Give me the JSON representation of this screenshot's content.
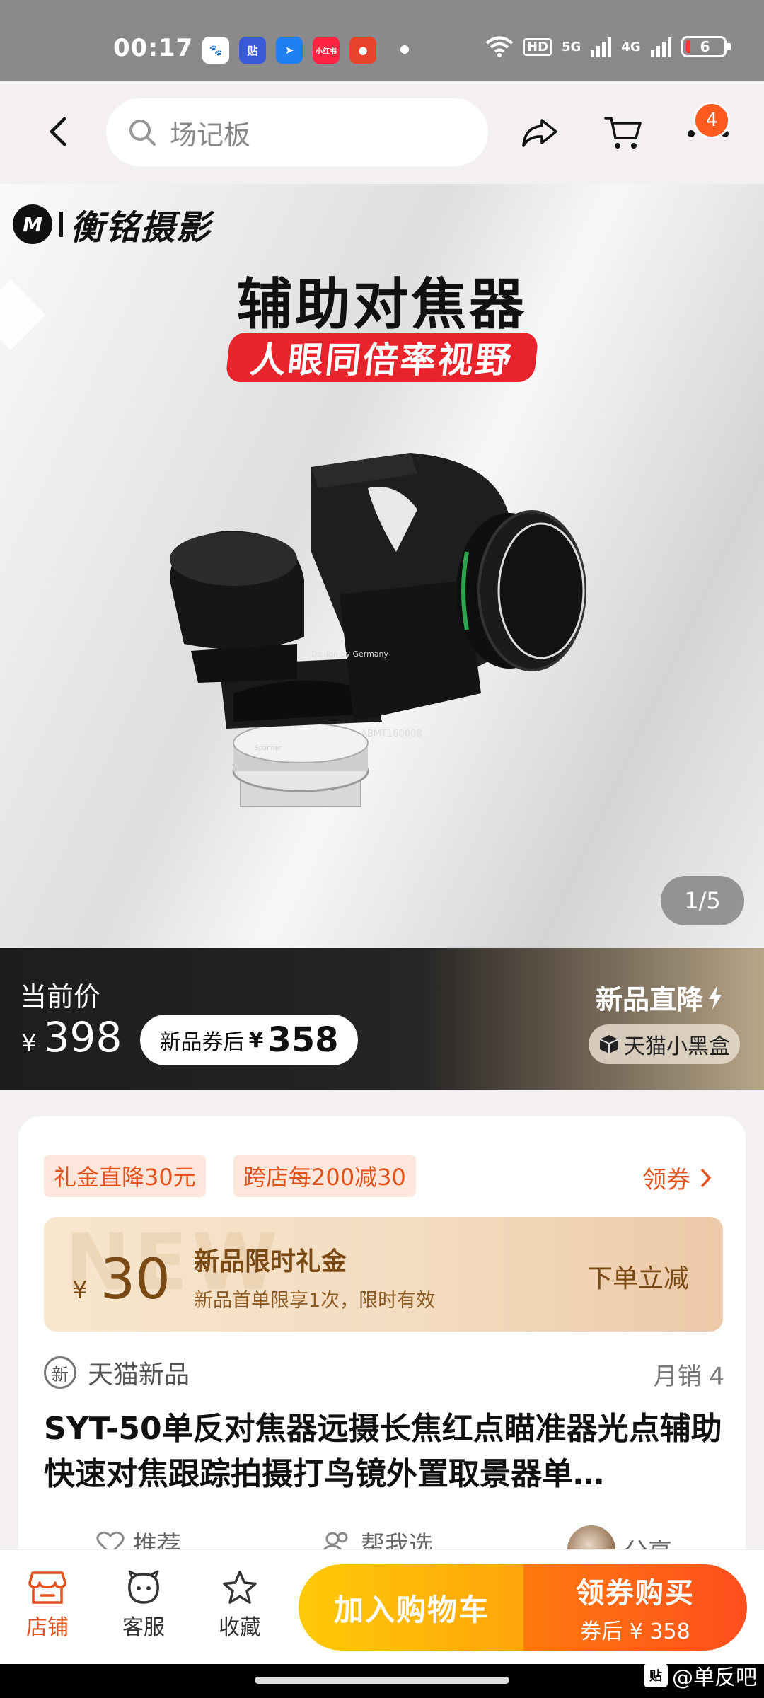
{
  "status_bar": {
    "time": "00:17",
    "apps": [
      {
        "icon": "baidu-app-icon",
        "glyph": "🐾",
        "color": "#ffffff",
        "text_color": "#2f5bd6"
      },
      {
        "icon": "tieba-app-icon",
        "glyph": "贴",
        "color": "#3a5bd9",
        "text_color": "#ffffff"
      },
      {
        "icon": "arrow-app-icon",
        "glyph": "➤",
        "color": "#1f7ef0",
        "text_color": "#ffffff"
      },
      {
        "icon": "xiaohongshu-app-icon",
        "glyph": "小红书",
        "color": "#ff2442",
        "text_color": "#ffffff"
      },
      {
        "icon": "game-app-icon",
        "glyph": "●",
        "color": "#e8422a",
        "text_color": "#ffffff"
      }
    ],
    "hd_label": "HD",
    "network_1": "5G",
    "network_2": "4G",
    "battery": "6"
  },
  "nav": {
    "search_placeholder": "场记板",
    "cart_badge": "4"
  },
  "gallery": {
    "brand_mark": "M",
    "brand_name": "衡铭摄影",
    "promo_title": "辅助对焦器",
    "promo_subtitle": "人眼同倍率视野",
    "device_text_1": "Design by Germany",
    "device_text_2": "ABMT160008",
    "device_text_3": "Spanner",
    "page_indicator": "1/5"
  },
  "price": {
    "current_label": "当前价",
    "currency": "¥",
    "current_value": "398",
    "coupon_label": "新品券后",
    "coupon_currency": "¥",
    "coupon_value": "358",
    "new_drop_label": "新品直降",
    "black_box_label": "天猫小黑盒"
  },
  "promo": {
    "tags": [
      "礼金直降30元",
      "跨店每200减30"
    ],
    "claim_label": "领券",
    "gift_currency": "¥",
    "gift_amount": "30",
    "gift_watermark": "NEW",
    "gift_title": "新品限时礼金",
    "gift_desc": "新品首单限享1次，限时有效",
    "gift_action": "下单立减"
  },
  "product": {
    "source_icon_text": "新",
    "source": "天猫新品",
    "monthly_sales": "月销 4",
    "title": "SYT-50单反对焦器远摄长焦红点瞄准器光点辅助快速对焦跟踪拍摄打鸟镜外置取景器单…",
    "actions": [
      "推荐",
      "帮我选",
      "分享"
    ]
  },
  "bottom_bar": {
    "shop": "店铺",
    "service": "客服",
    "favorite": "收藏",
    "add_to_cart": "加入购物车",
    "buy_main": "领券购买",
    "buy_sub": "券后 ¥ 358"
  },
  "watermark": {
    "icon_text": "贴",
    "text": "@单反吧"
  },
  "colors": {
    "accent": "#e2521d",
    "cart_button": "#ffb30a",
    "buy_button": "#ff5a1f"
  }
}
